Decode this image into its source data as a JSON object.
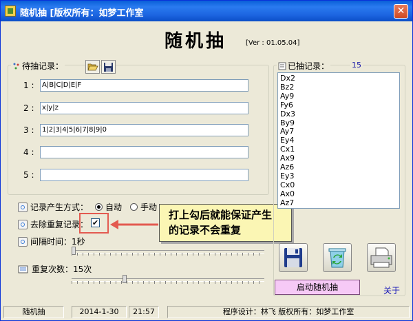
{
  "window": {
    "title": "随机抽  [版权所有：如梦工作室",
    "close_symbol": "✕"
  },
  "header": {
    "title": "随机抽",
    "version": "[Ver : 01.05.04]"
  },
  "pending": {
    "legend": "待抽记录：",
    "records": [
      {
        "label": "1 :",
        "value": "A|B|C|D|E|F"
      },
      {
        "label": "2 :",
        "value": "x|y|z"
      },
      {
        "label": "3 :",
        "value": "1|2|3|4|5|6|7|8|9|0"
      },
      {
        "label": "4 :",
        "value": ""
      },
      {
        "label": "5 :",
        "value": ""
      }
    ]
  },
  "options": {
    "mode_label": "记录产生方式：",
    "mode_auto": "自动",
    "mode_manual": "手动",
    "dedupe_label": "去除重复记录：",
    "dedupe_check": "✔",
    "interval_label": "间隔时间：1秒",
    "repeat_label": "重复次数：15次",
    "interval_level": 0.0,
    "repeat_level": 0.27
  },
  "callout": {
    "line1": "打上勾后就能保证产生",
    "line2": "的记录不会重复"
  },
  "drawn": {
    "legend": "已抽记录：",
    "count": "15",
    "items": [
      "Dx2",
      "Bz2",
      "Ay9",
      "Fy6",
      "Dx3",
      "By9",
      "Ay7",
      "Ey4",
      "Cx1",
      "Ax9",
      "Az6",
      "Ey3",
      "Cx0",
      "Ax0",
      "Az7"
    ]
  },
  "buttons": {
    "start": "启动随机抽",
    "about": "关于"
  },
  "status": {
    "app": "随机抽",
    "date": "2014-1-30",
    "time": "21:57",
    "credit": "程序设计：林飞   版权所有：如梦工作室"
  }
}
